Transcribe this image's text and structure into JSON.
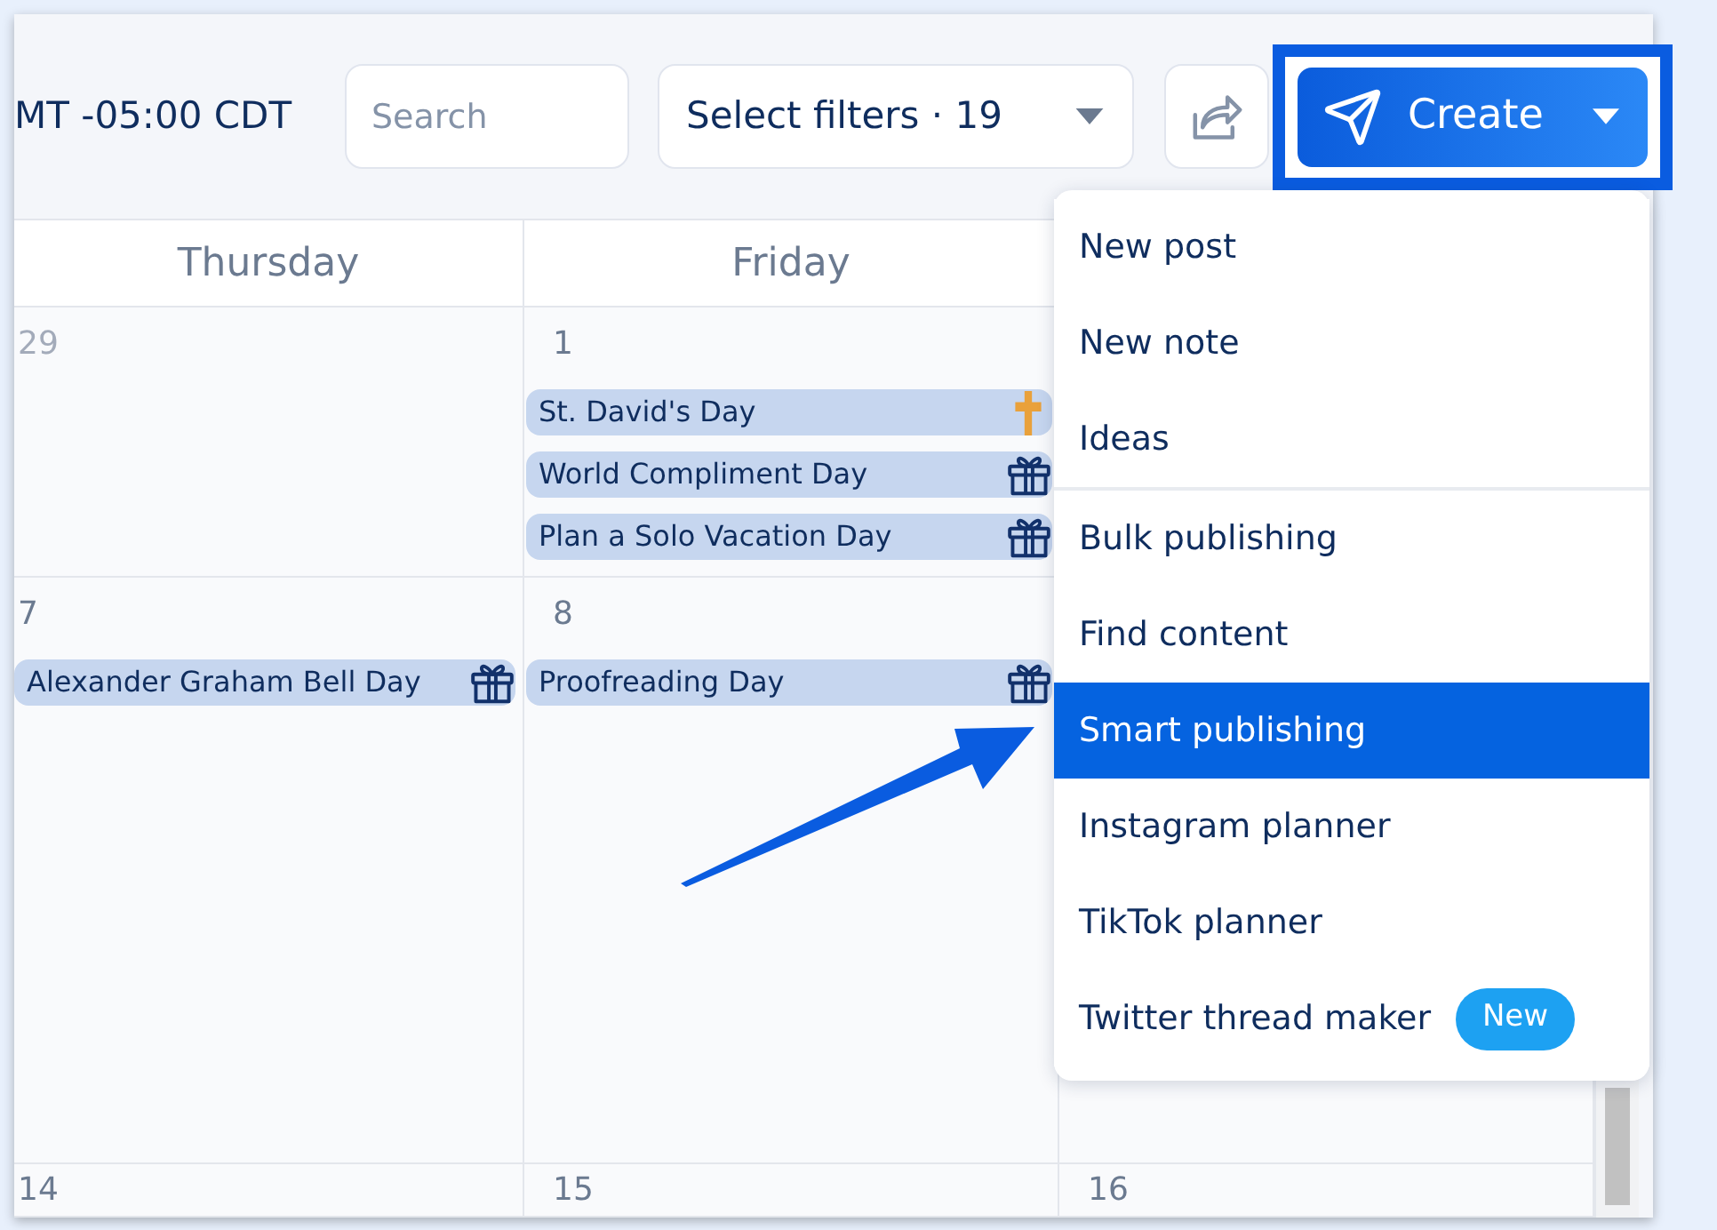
{
  "toolbar": {
    "timezone": "MT -05:00 CDT",
    "search": {
      "placeholder": "Search"
    },
    "filters": {
      "label": "Select filters · 19"
    },
    "create_button": {
      "label": "Create",
      "highlighted": true
    }
  },
  "calendar": {
    "day_headers": [
      "Thursday",
      "Friday"
    ],
    "weeks": [
      {
        "days": [
          {
            "date": "29",
            "other_month": true
          },
          {
            "date": "1",
            "other_month": false,
            "events": [
              {
                "title": "St. David's Day",
                "kind": "religious"
              },
              {
                "title": "World Compliment Day",
                "kind": "observance"
              },
              {
                "title": "Plan a Solo Vacation Day",
                "kind": "observance"
              }
            ]
          }
        ]
      },
      {
        "days": [
          {
            "date": "7",
            "other_month": false,
            "events": [
              {
                "title": "Alexander Graham Bell Day",
                "kind": "observance"
              }
            ]
          },
          {
            "date": "8",
            "other_month": false,
            "events": [
              {
                "title": "Proofreading Day",
                "kind": "observance"
              }
            ]
          }
        ]
      },
      {
        "days": [
          {
            "date": "14",
            "other_month": false
          },
          {
            "date": "15",
            "other_month": false
          },
          {
            "date": "16",
            "other_month": false
          }
        ]
      }
    ]
  },
  "create_menu": {
    "groups": [
      {
        "items": [
          {
            "label": "New post",
            "selected": false
          },
          {
            "label": "New note",
            "selected": false
          },
          {
            "label": "Ideas",
            "selected": false
          }
        ]
      },
      {
        "items": [
          {
            "label": "Bulk publishing",
            "selected": false
          },
          {
            "label": "Find content",
            "selected": false
          },
          {
            "label": "Smart publishing",
            "selected": true
          },
          {
            "label": "Instagram planner",
            "selected": false
          },
          {
            "label": "TikTok planner",
            "selected": false
          },
          {
            "label": "Twitter thread maker",
            "selected": false,
            "badge": "New"
          }
        ]
      }
    ]
  }
}
